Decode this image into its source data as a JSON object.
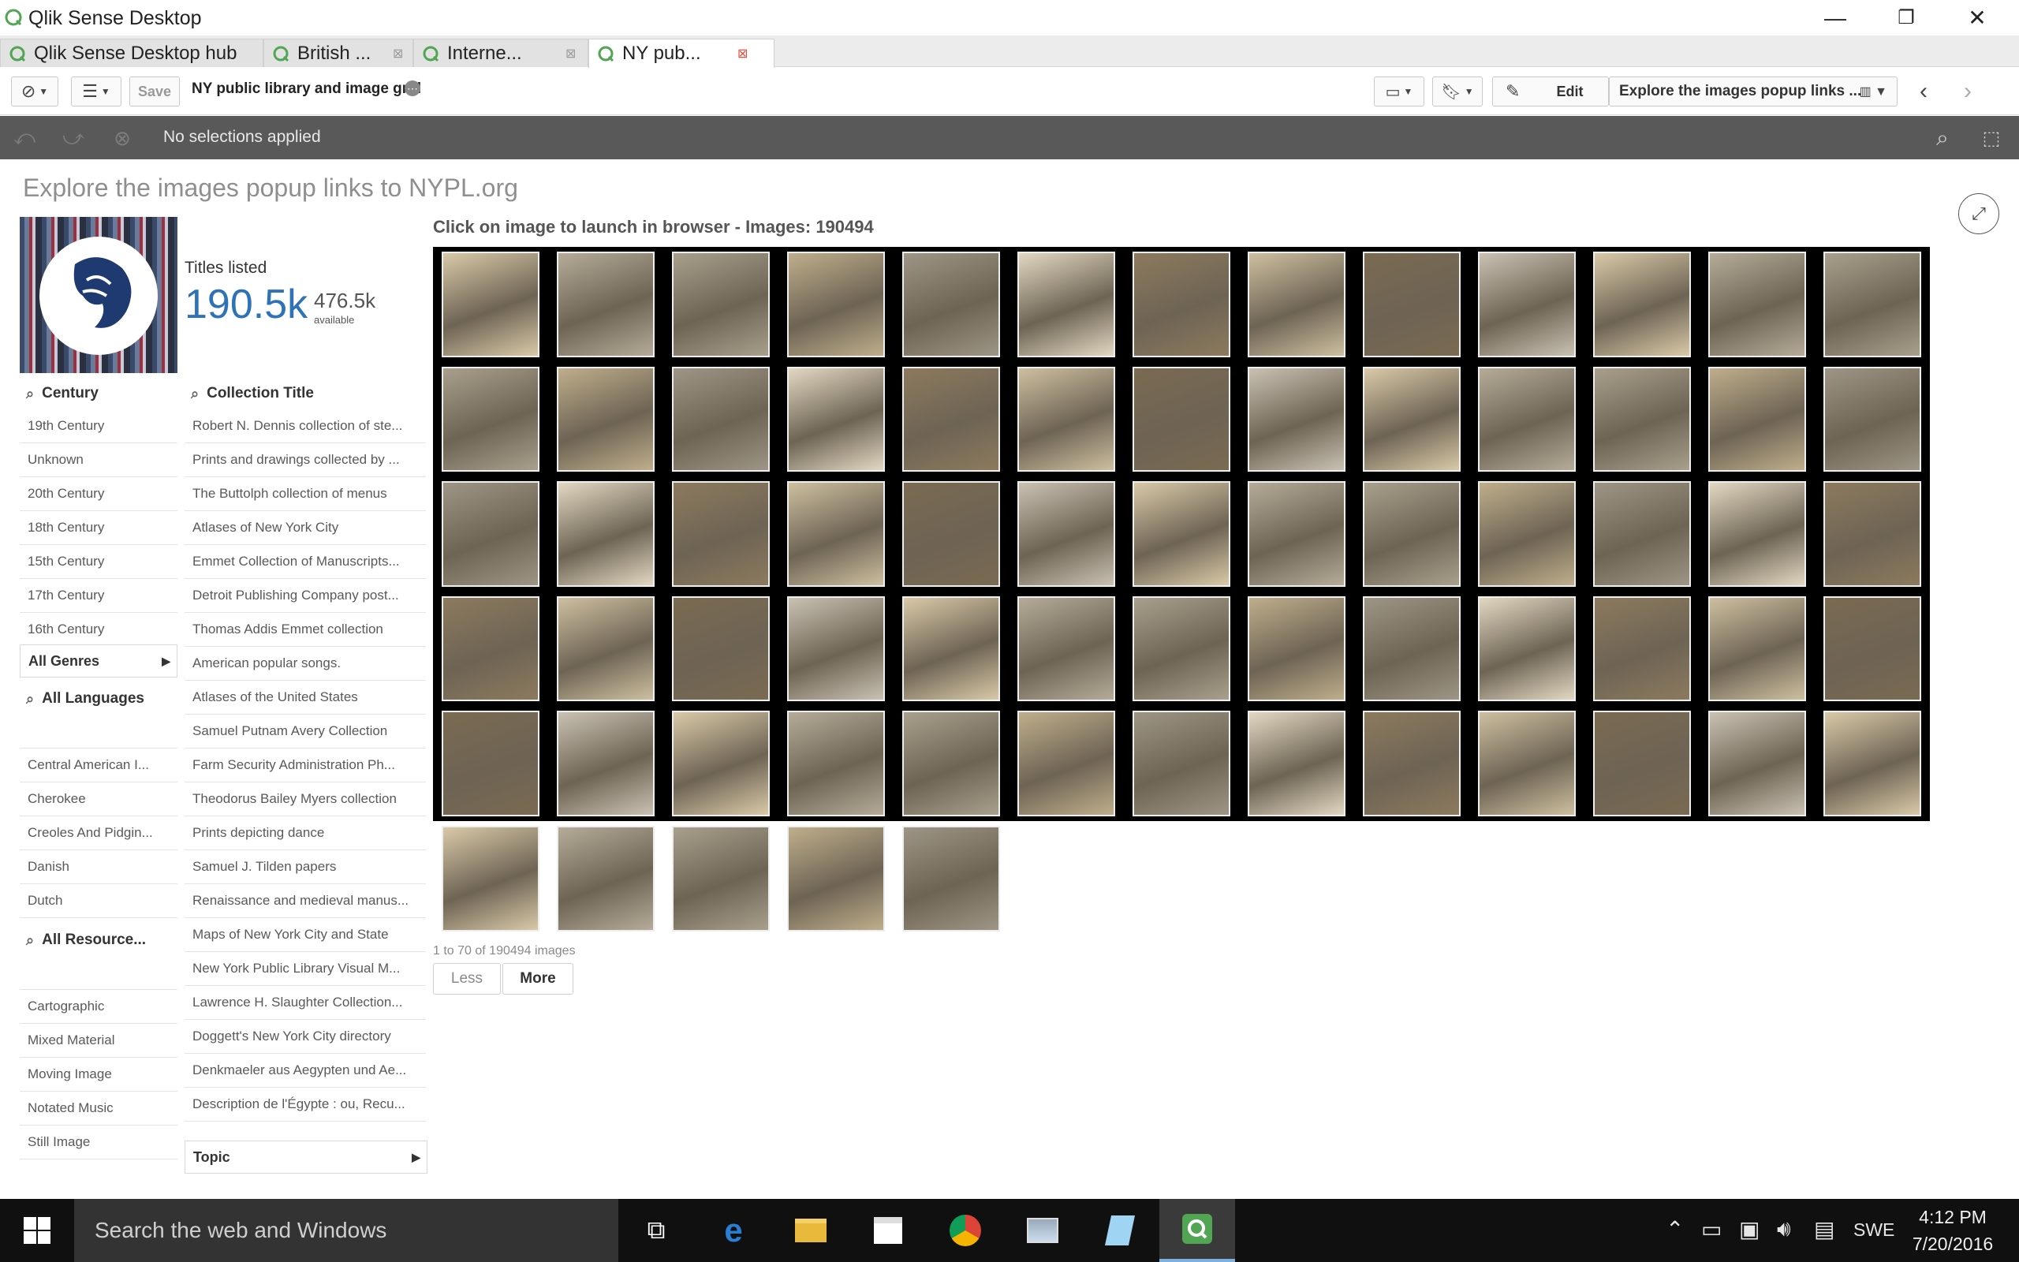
{
  "window": {
    "title": "Qlik Sense Desktop",
    "minimize": "—",
    "restore": "❐",
    "close": "✕"
  },
  "tabs": [
    {
      "label": "Qlik Sense Desktop hub",
      "active": false,
      "closable": false
    },
    {
      "label": "British ...",
      "active": false,
      "closable": true
    },
    {
      "label": "Interne...",
      "active": false,
      "closable": true
    },
    {
      "label": "NY pub...",
      "active": true,
      "closable": true
    }
  ],
  "toolbar": {
    "save_label": "Save",
    "app_name": "NY public library and image grid",
    "edit_label": "Edit",
    "sheet_selector": "Explore the images popup links ..."
  },
  "selections": {
    "status": "No selections applied"
  },
  "sheet": {
    "title": "Explore the images popup links to NYPL.org"
  },
  "kpi": {
    "label": "Titles listed",
    "main_value": "190.5k",
    "secondary_value": "476.5k",
    "secondary_caption": "available"
  },
  "century_list": {
    "title": "Century",
    "items": [
      "19th Century",
      "Unknown",
      "20th Century",
      "18th Century",
      "15th Century",
      "17th Century",
      "16th Century"
    ]
  },
  "genres": {
    "label": "All Genres"
  },
  "languages_list": {
    "title": "All Languages",
    "items": [
      "",
      "Central American I...",
      "Cherokee",
      "Creoles And Pidgin...",
      "Danish",
      "Dutch"
    ]
  },
  "resource_list": {
    "title": "All Resource...",
    "items": [
      "",
      "Cartographic",
      "Mixed Material",
      "Moving Image",
      "Notated Music",
      "Still Image"
    ]
  },
  "collection_list": {
    "title": "Collection Title",
    "items": [
      "Robert N. Dennis collection of ste...",
      "Prints and drawings collected by ...",
      "The Buttolph collection of menus",
      "Atlases of New York City",
      "Emmet Collection of Manuscripts...",
      "Detroit Publishing Company post...",
      "Thomas Addis Emmet collection",
      "American popular songs.",
      "Atlases of the United States",
      "Samuel Putnam Avery Collection",
      "Farm Security Administration Ph...",
      "Theodorus Bailey Myers collection",
      "Prints depicting dance",
      "Samuel J. Tilden papers",
      "Renaissance and medieval manus...",
      "Maps of New York City and State",
      "New York Public Library Visual M...",
      "Lawrence H. Slaughter Collection...",
      "Doggett's New York City directory",
      "Denkmaeler aus Aegypten und Ae...",
      "Description de l'Égypte : ou, Recu..."
    ]
  },
  "topic": {
    "label": "Topic"
  },
  "image_grid": {
    "title": "Click on image to launch in browser - Images: 190494",
    "footer": "1 to 70 of 190494 images",
    "less_label": "Less",
    "more_label": "More",
    "image_count": 70,
    "columns": 13
  },
  "taskbar": {
    "search_placeholder": "Search the web and Windows",
    "language": "SWE",
    "time": "4:12 PM",
    "date": "7/20/2016"
  },
  "colors": {
    "accent_blue": "#2e72b8",
    "selection_bar": "#595959",
    "qlik_green": "#52a552",
    "close_red": "#e04a3a"
  }
}
